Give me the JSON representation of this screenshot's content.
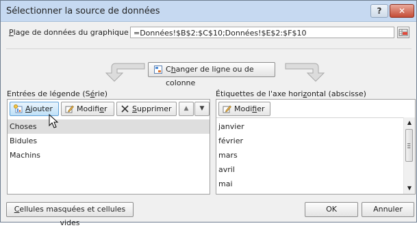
{
  "window": {
    "title": "Sélectionner la source de données",
    "help_label": "?",
    "close_label": "✕"
  },
  "range": {
    "label_pre": "",
    "label_ul": "P",
    "label_post": "lage de données du graphique :",
    "value": "=Données!$B$2:$C$10;Données!$E$2:$F$10"
  },
  "switch_button": {
    "pre": "C",
    "ul": "h",
    "post": "anger de ligne ou de colonne"
  },
  "legend": {
    "label_pre": "Entrées de légende (S",
    "label_ul": "é",
    "label_post": "rie)",
    "add": {
      "pre": "",
      "ul": "A",
      "post": "jouter"
    },
    "edit": {
      "pre": "Modifi",
      "ul": "e",
      "post": "r"
    },
    "remove": {
      "pre": "",
      "ul": "S",
      "post": "upprimer"
    },
    "up_arrow": "▲",
    "down_arrow": "▼",
    "items": [
      "Choses",
      "Bidules",
      "Machins"
    ]
  },
  "axis": {
    "label_pre": "Étiquettes de l'axe hori",
    "label_ul": "z",
    "label_post": "ontal (abscisse)",
    "edit": {
      "pre": "Modi",
      "ul": "f",
      "post": "ier"
    },
    "items": [
      "janvier",
      "février",
      "mars",
      "avril",
      "mai"
    ]
  },
  "footer": {
    "hidden_cells": {
      "pre": "",
      "ul": "C",
      "post": "ellules masquées et cellules vides"
    },
    "ok": "OK",
    "cancel": "Annuler"
  },
  "colors": {
    "title_bar": "#c6d9f1",
    "selection": "#dedede",
    "active_button": "#bfe0f7",
    "close_button": "#c44c36"
  }
}
